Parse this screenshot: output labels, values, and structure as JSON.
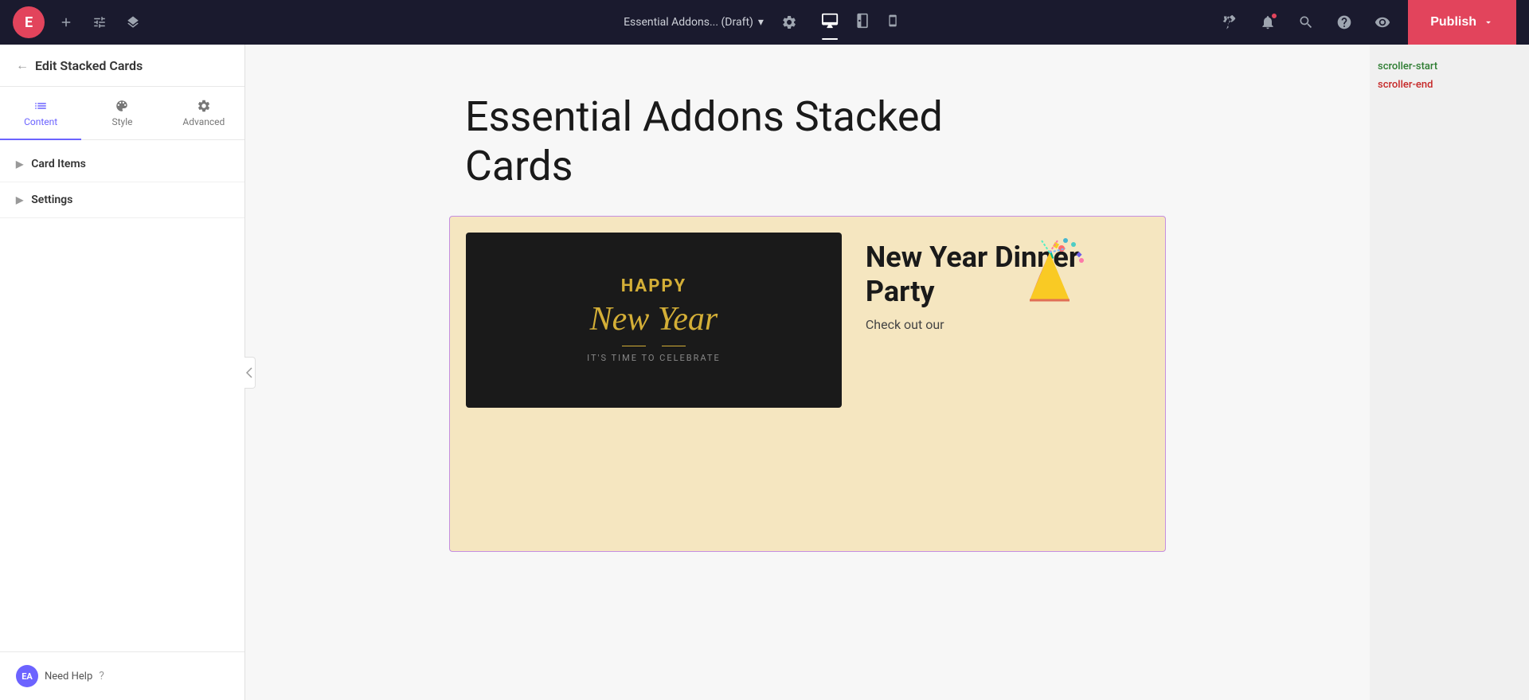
{
  "topbar": {
    "logo_letter": "E",
    "site_name": "Essential Addons... (Draft)",
    "publish_label": "Publish",
    "add_icon": "+",
    "customize_icon": "customize",
    "layers_icon": "layers",
    "chevron_down": "▾"
  },
  "sidebar": {
    "title": "Edit Stacked Cards",
    "tabs": [
      {
        "id": "content",
        "label": "Content",
        "active": true
      },
      {
        "id": "style",
        "label": "Style",
        "active": false
      },
      {
        "id": "advanced",
        "label": "Advanced",
        "active": false
      }
    ],
    "accordion": [
      {
        "id": "card-items",
        "label": "Card Items"
      },
      {
        "id": "settings",
        "label": "Settings"
      }
    ],
    "footer": {
      "badge": "EA",
      "help_text": "Need Help",
      "help_icon": "?"
    }
  },
  "canvas": {
    "main_title_line1": "Essential Addons Stacked",
    "main_title_line2": "Cards",
    "card": {
      "background_color": "#f5e6c0",
      "image_bg": "#1a1a1a",
      "happy_text": "HAPPY",
      "new_year_text": "New Year",
      "celebrate_text": "IT'S TIME TO CELEBRATE",
      "title": "New Year Dinner Party",
      "description": "Check out our"
    }
  },
  "right_panel": {
    "scroller_start": "scroller-start",
    "scroller_end": "scroller-end"
  },
  "devices": [
    {
      "id": "desktop",
      "active": true
    },
    {
      "id": "tablet",
      "active": false
    },
    {
      "id": "mobile",
      "active": false
    }
  ]
}
